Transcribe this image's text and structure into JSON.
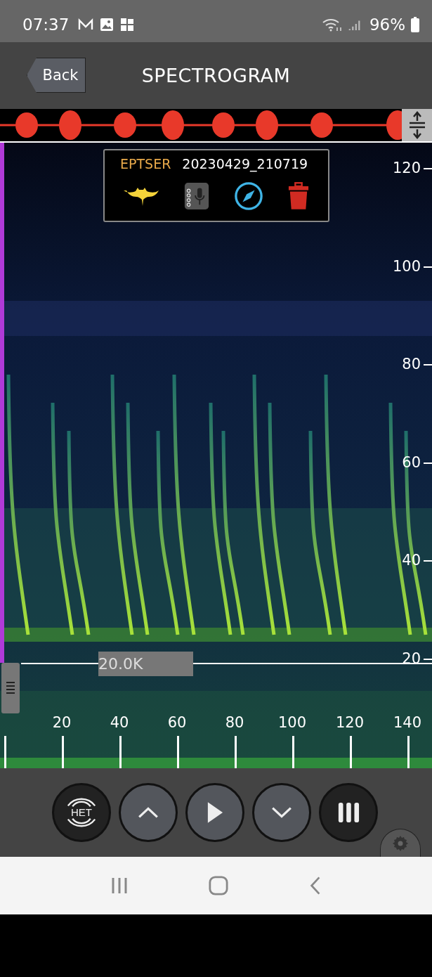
{
  "status_bar": {
    "time": "07:37",
    "battery": "96%"
  },
  "header": {
    "back": "Back",
    "title": "SPECTROGRAM"
  },
  "recording": {
    "species": "EPTSER",
    "name": "20230429_210719"
  },
  "y_axis": [
    "120",
    "100",
    "80",
    "60",
    "40",
    "20"
  ],
  "threshold": "20.0K",
  "x_axis": [
    "20",
    "40",
    "60",
    "80",
    "100",
    "120",
    "140"
  ],
  "controls": [
    {
      "kind": "het",
      "label": "HET"
    },
    {
      "kind": "up"
    },
    {
      "kind": "play"
    },
    {
      "kind": "down"
    },
    {
      "kind": "pause"
    }
  ]
}
